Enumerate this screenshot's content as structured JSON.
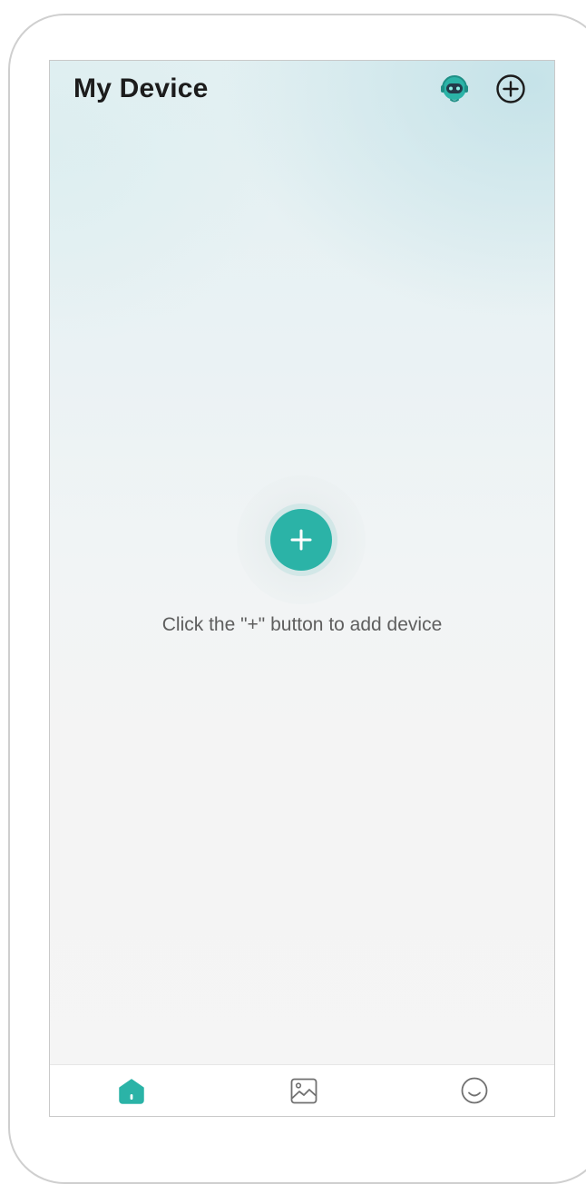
{
  "header": {
    "title": "My Device",
    "support_icon": "customer-service-robot-icon",
    "add_icon": "plus-circle-icon"
  },
  "empty_state": {
    "add_icon": "plus-icon",
    "hint": "Click the \"+\" button to add device"
  },
  "tabbar": {
    "tabs": [
      {
        "icon": "home-icon",
        "active": true
      },
      {
        "icon": "gallery-icon",
        "active": false
      },
      {
        "icon": "profile-icon",
        "active": false
      }
    ]
  },
  "colors": {
    "accent": "#2bb3a7",
    "title": "#1c1c1c",
    "hint": "#5e5e5e",
    "inactive_icon": "#707070"
  }
}
